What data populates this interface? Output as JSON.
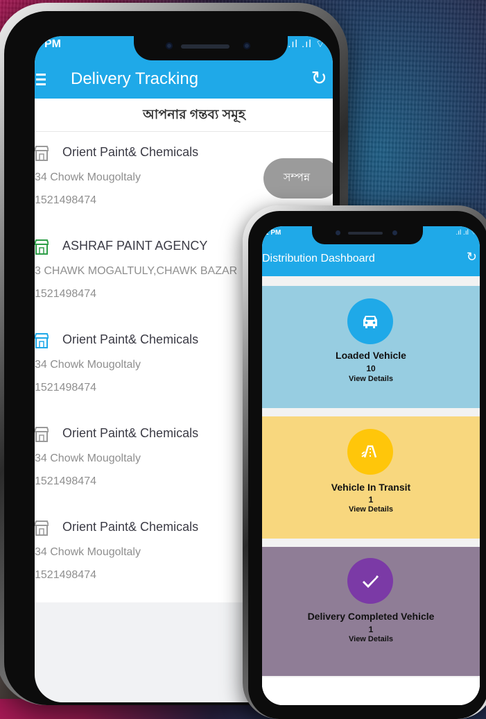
{
  "colors": {
    "header": "#1fa9e8",
    "loaded": "#97cde1",
    "transit": "#f8d77e",
    "completed": "#8f7d96"
  },
  "phone1": {
    "status_time": "PM",
    "status_icons": ".ıl .ıl ⌔",
    "app_title": "Delivery Tracking",
    "subheader": "আপনার গন্তব্য সমূহ",
    "done_button": "সম্পন্ন",
    "destinations": [
      {
        "name": "Orient Paint& Chemicals",
        "address": "34 Chowk Mougoltaly",
        "phone": "1521498474",
        "icon_color": "#9a9a9a"
      },
      {
        "name": "ASHRAF PAINT AGENCY",
        "address": "3 CHAWK MOGALTULY,CHAWK BAZAR",
        "phone": "1521498474",
        "icon_color": "#2e9e48"
      },
      {
        "name": "Orient Paint& Chemicals",
        "address": "34 Chowk Mougoltaly",
        "phone": "1521498474",
        "icon_color": "#1fa9e8"
      },
      {
        "name": "Orient Paint& Chemicals",
        "address": "34 Chowk Mougoltaly",
        "phone": "1521498474",
        "icon_color": "#9a9a9a"
      },
      {
        "name": "Orient Paint& Chemicals",
        "address": "34 Chowk Mougoltaly",
        "phone": "1521498474",
        "icon_color": "#9a9a9a"
      }
    ]
  },
  "phone2": {
    "status_time": "1 PM",
    "status_icons": ".ıl .ıl ⌔",
    "app_title": "Distribution Dashboard",
    "cards": [
      {
        "label": "Loaded Vehicle",
        "count": "10",
        "details": "View Details",
        "icon": "car-icon"
      },
      {
        "label": "Vehicle In Transit",
        "count": "1",
        "details": "View Details",
        "icon": "road-icon"
      },
      {
        "label": "Delivery Completed Vehicle",
        "count": "1",
        "details": "View Details",
        "icon": "check-icon"
      }
    ]
  }
}
